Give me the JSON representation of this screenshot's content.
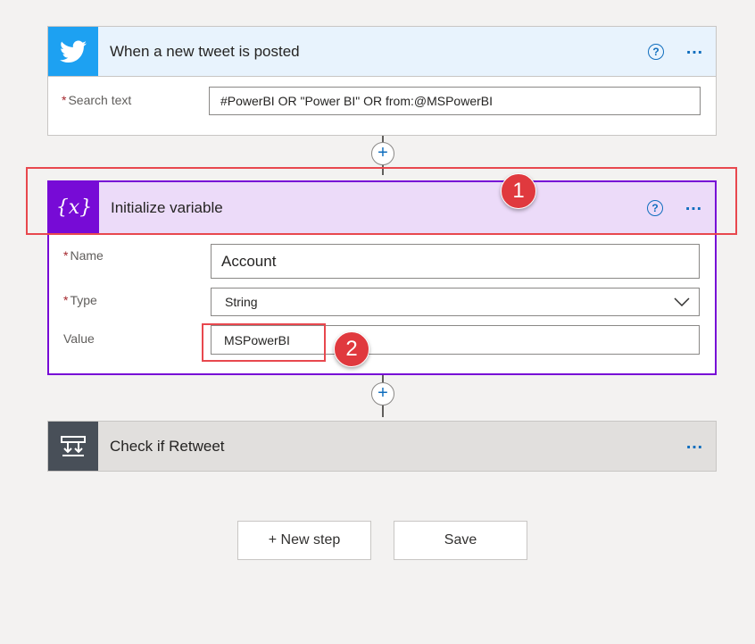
{
  "trigger": {
    "title": "When a new tweet is posted",
    "fields": [
      {
        "label": "Search text",
        "required": true,
        "value": "#PowerBI OR \"Power BI\" OR from:@MSPowerBI"
      }
    ]
  },
  "init_variable": {
    "title": "Initialize variable",
    "fields": [
      {
        "label": "Name",
        "value": "Account"
      },
      {
        "label": "Type",
        "value": "String"
      },
      {
        "label": "Value",
        "value": "MSPowerBI"
      }
    ]
  },
  "condition": {
    "title": "Check if Retweet"
  },
  "buttons": {
    "new_step": "+ New step",
    "save": "Save"
  },
  "connectors": {
    "plus_symbol": "+"
  },
  "annotations": {
    "badge1": "1",
    "badge2": "2"
  },
  "icons": {
    "help": "?",
    "more": "…",
    "variable": "{x}"
  },
  "colors": {
    "twitter_blue": "#1da1f2",
    "variable_purple": "#770bd6",
    "condition_dark": "#484f58",
    "accent_blue": "#106ebe",
    "annotation_red": "#e0393e"
  }
}
